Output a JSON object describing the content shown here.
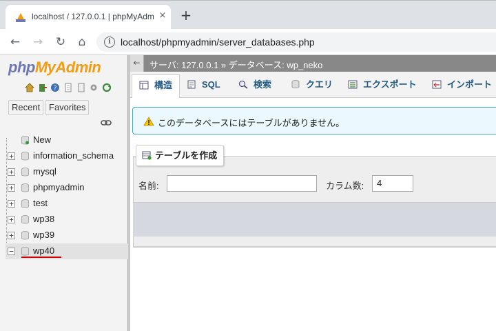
{
  "browser": {
    "tab_title": "localhost / 127.0.0.1 | phpMyAdm",
    "tab_close": "×",
    "new_tab": "+",
    "back": "←",
    "forward": "→",
    "reload": "↻",
    "home": "⌂",
    "url": "localhost/phpmyadmin/server_databases.php"
  },
  "sidebar": {
    "logo_php": "php",
    "logo_admin": "MyAdmin",
    "recent_label": "Recent",
    "favorites_label": "Favorites",
    "items": [
      {
        "label": "New",
        "expander": ""
      },
      {
        "label": "information_schema",
        "expander": "+"
      },
      {
        "label": "mysql",
        "expander": "+"
      },
      {
        "label": "phpmyadmin",
        "expander": "+"
      },
      {
        "label": "test",
        "expander": "+"
      },
      {
        "label": "wp38",
        "expander": "+"
      },
      {
        "label": "wp39",
        "expander": "+"
      },
      {
        "label": "wp40",
        "expander": "−"
      }
    ],
    "active_item": "wp40",
    "accent_color": "#d40000"
  },
  "main": {
    "collapse": "←",
    "breadcrumb": "サーバ: 127.0.0.1 » データベース: wp_neko",
    "tabs": [
      {
        "label": "構造",
        "active": true
      },
      {
        "label": "SQL",
        "active": false
      },
      {
        "label": "検索",
        "active": false
      },
      {
        "label": "クエリ",
        "active": false
      },
      {
        "label": "エクスポート",
        "active": false
      },
      {
        "label": "インポート",
        "active": false
      }
    ],
    "notice": "このデータベースにはテーブルがありません。",
    "create_table": {
      "legend": "テーブルを作成",
      "name_label": "名前:",
      "name_value": "",
      "columns_label": "カラム数:",
      "columns_value": "4"
    }
  }
}
